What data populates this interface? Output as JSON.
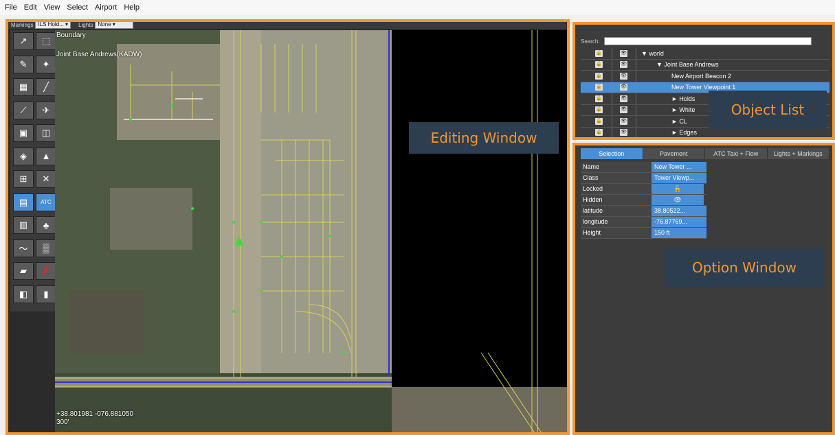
{
  "menu": [
    "File",
    "Edit",
    "View",
    "Select",
    "Airport",
    "Help"
  ],
  "options_bar": {
    "markings_label": "Markings",
    "markings_value": "ILS Hold...",
    "lights_label": "Lights",
    "lights_value": "None"
  },
  "map": {
    "boundary_label": "Boundary",
    "airport_name": "Joint Base Andrews(KADW)",
    "coordinates": "+38.801981 -076.881050",
    "scale": "300'"
  },
  "toolbox": [
    "arrow-tool",
    "marquee-tool",
    "crop-tool",
    "beacon-tool",
    "sign-tool",
    "runway-tool",
    "taxiway-tool",
    "helipad-tool",
    "ramp-tool",
    "sign-marker-tool",
    "object-tool",
    "windsock-tool",
    "tower-tool",
    "light-fixture-tool",
    "boundary-tool",
    "atc-tool",
    "facade-tool",
    "forest-tool",
    "line-tool",
    "string-tool",
    "polygon-tool",
    "delete-tool",
    "exclusion-tool",
    "preview-tool"
  ],
  "object_list": {
    "search_label": "Search:",
    "search_value": "",
    "rows": [
      {
        "label": "world",
        "indent": 0,
        "arrow": "▼",
        "selected": false
      },
      {
        "label": "Joint Base Andrews",
        "indent": 1,
        "arrow": "▼",
        "selected": false
      },
      {
        "label": "New Airport Beacon 2",
        "indent": 2,
        "arrow": "",
        "selected": false
      },
      {
        "label": "New Tower Viewpoint 1",
        "indent": 2,
        "arrow": "",
        "selected": true
      },
      {
        "label": "Holds",
        "indent": 2,
        "arrow": "►",
        "selected": false
      },
      {
        "label": "White",
        "indent": 2,
        "arrow": "►",
        "selected": false
      },
      {
        "label": "CL",
        "indent": 2,
        "arrow": "►",
        "selected": false
      },
      {
        "label": "Edges",
        "indent": 2,
        "arrow": "►",
        "selected": false
      }
    ]
  },
  "option_window": {
    "tabs": [
      "Selection",
      "Pavement",
      "ATC Taxi + Flow",
      "Lights + Markings"
    ],
    "active_tab": "Selection",
    "properties": [
      {
        "key": "Name",
        "value": "New Tower ..."
      },
      {
        "key": "Class",
        "value": "Tower Viewp..."
      },
      {
        "key": "Locked",
        "value": "🔓"
      },
      {
        "key": "Hidden",
        "value": "👁"
      },
      {
        "key": "latitude",
        "value": "38.80522..."
      },
      {
        "key": "longitude",
        "value": "-76.87769..."
      },
      {
        "key": "Height",
        "value": "150 ft"
      }
    ]
  },
  "callouts": {
    "editing": "Editing Window",
    "object_list": "Object List",
    "option": "Option Window"
  },
  "colors": {
    "accent": "#f2962f",
    "selection": "#4a8fd6",
    "callout_bg": "#2d3e50"
  }
}
